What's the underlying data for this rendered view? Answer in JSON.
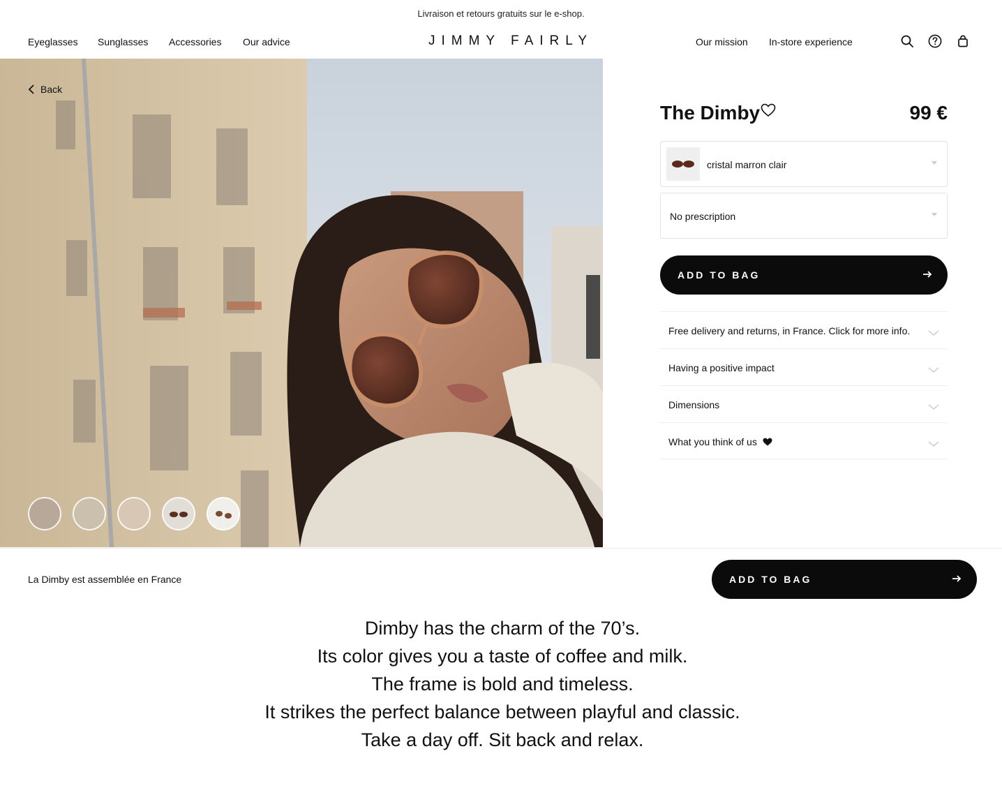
{
  "announcement": "Livraison et retours gratuits sur le e-shop.",
  "nav": {
    "left": [
      "Eyeglasses",
      "Sunglasses",
      "Accessories",
      "Our advice"
    ],
    "logo": "JIMMY FAIRLY",
    "right": [
      "Our mission",
      "In-store experience"
    ],
    "icons": [
      "search-icon",
      "help-icon",
      "bag-icon"
    ]
  },
  "hero": {
    "back_label": "Back",
    "thumbnails": [
      "thumbnail-1",
      "thumbnail-2",
      "thumbnail-3",
      "thumbnail-4",
      "thumbnail-5"
    ]
  },
  "product": {
    "name": "The Dimby",
    "price": "99 €",
    "color_option": "cristal marron clair",
    "prescription_option": "No prescription",
    "add_to_bag": "ADD TO BAG"
  },
  "accordion": [
    "Free delivery and returns, in France. Click for more info.",
    "Having a positive impact",
    "Dimensions",
    "What you think of us"
  ],
  "sticky_bar": {
    "text": "La Dimby est assemblée en France",
    "button": "ADD TO BAG"
  },
  "description": [
    "Dimby has the charm of the 70’s.",
    "Its color gives you a taste of coffee and milk.",
    "The frame is bold and timeless.",
    "It strikes the perfect balance between playful and classic.",
    "Take a day off. Sit back and relax."
  ],
  "colors": {
    "cta": "#0b0b0b",
    "text": "#111111",
    "border": "#e3e3e3"
  }
}
